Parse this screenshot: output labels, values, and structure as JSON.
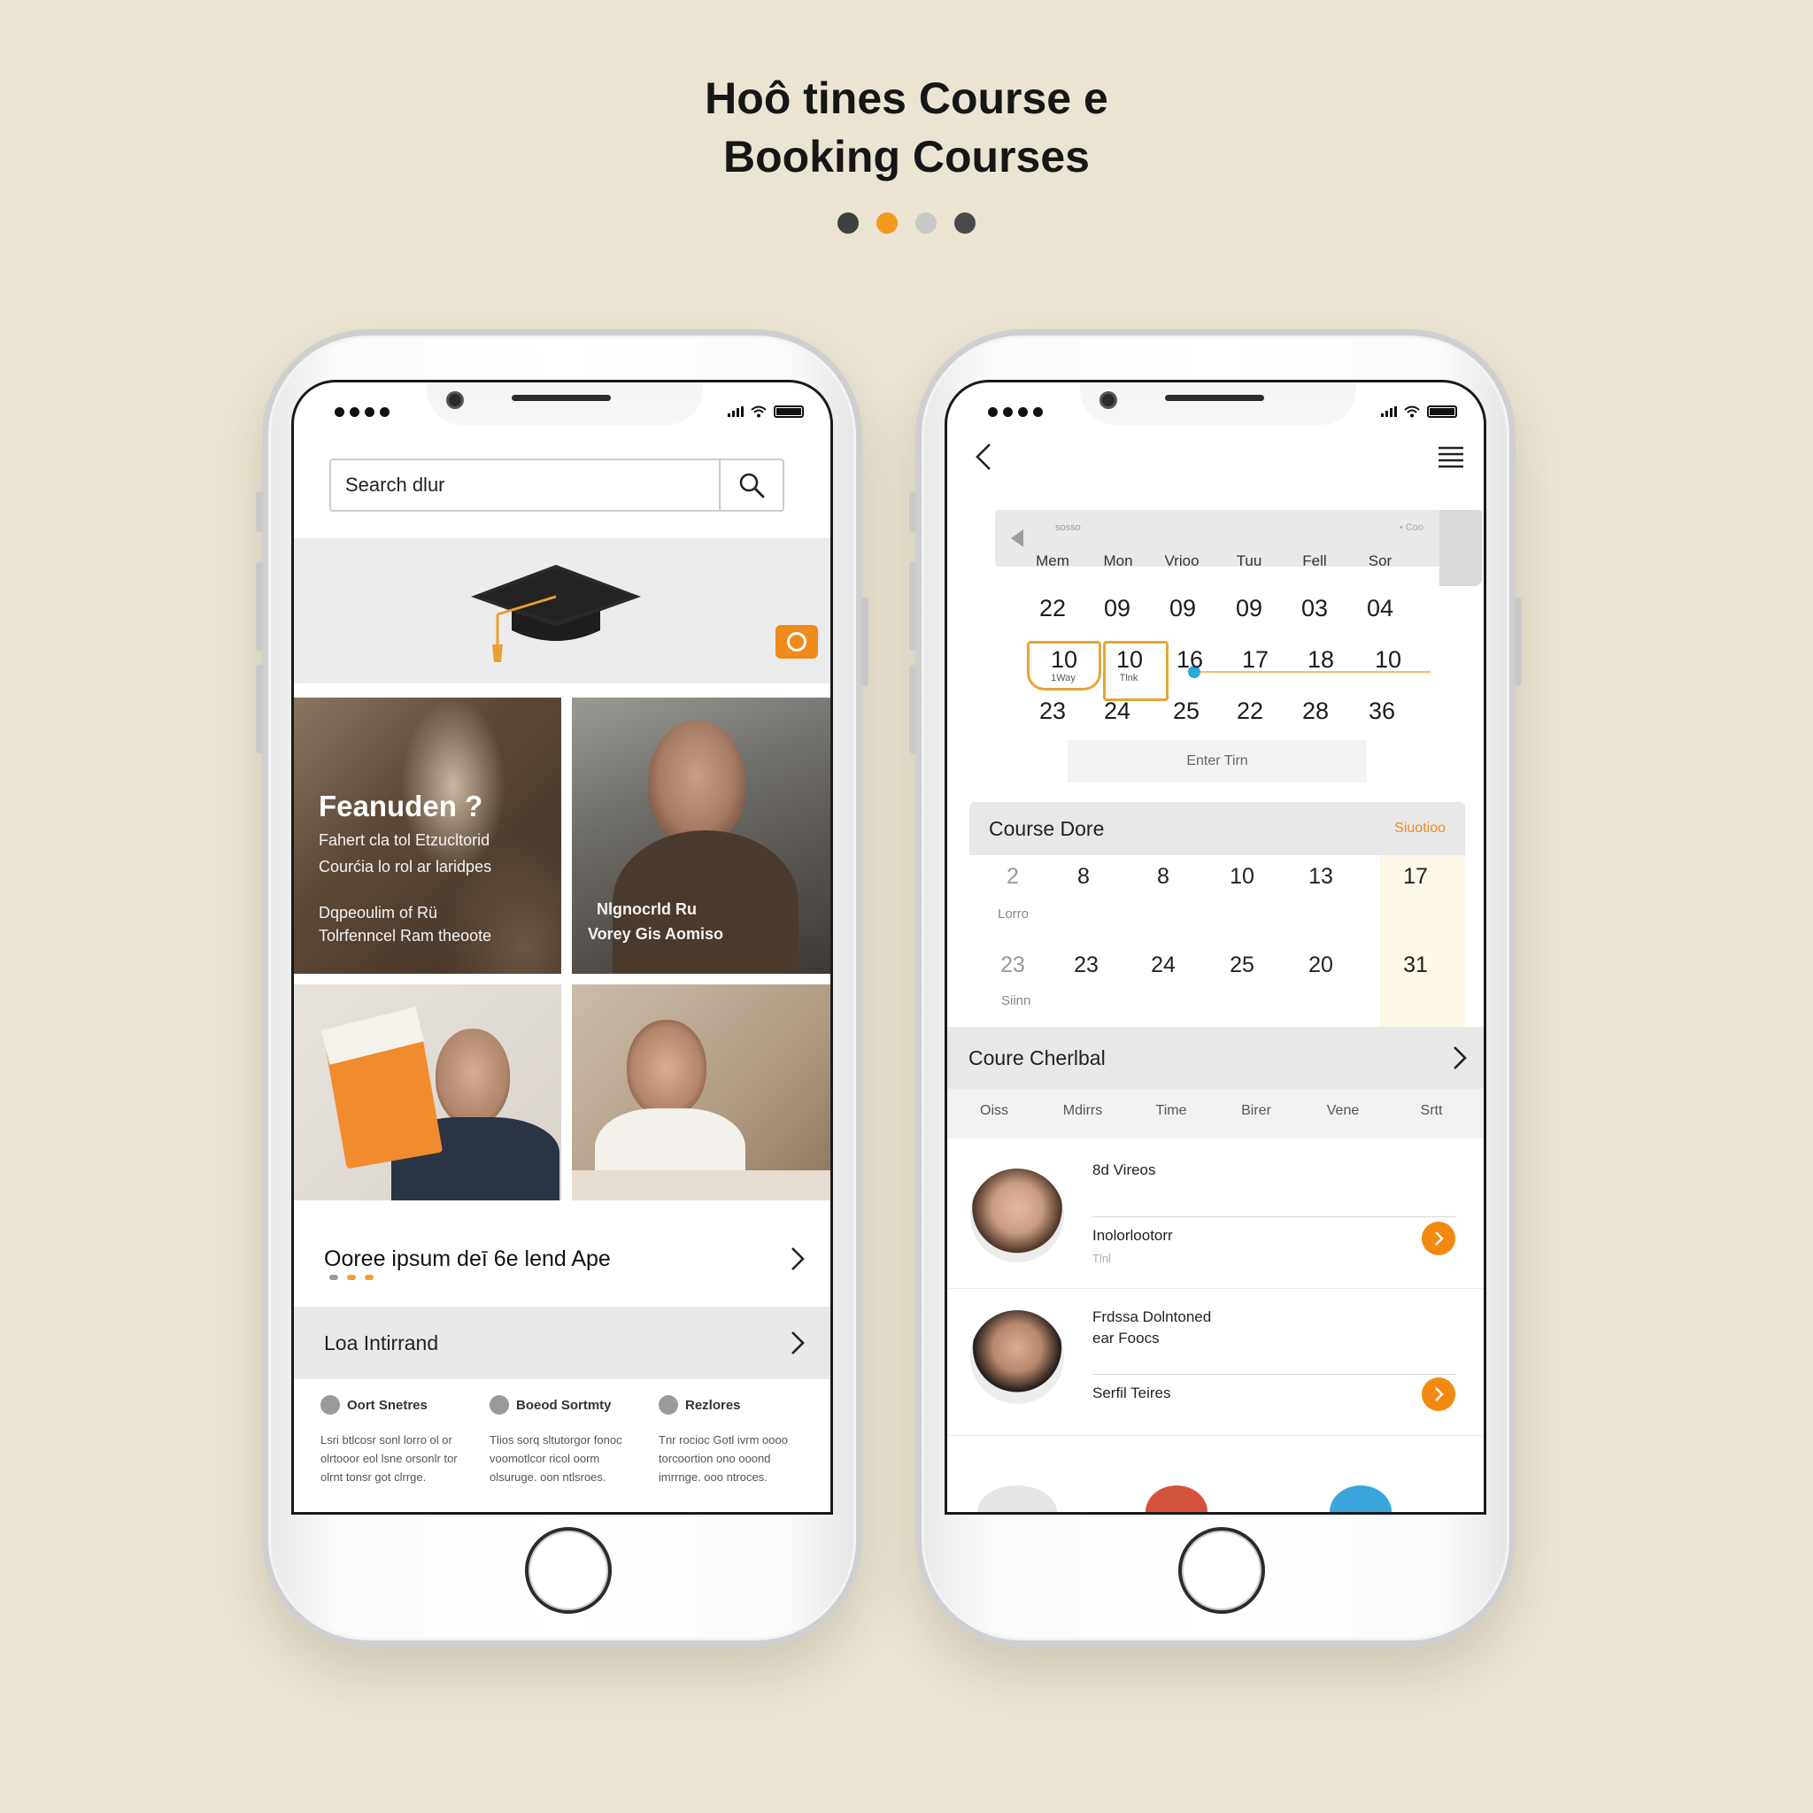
{
  "header": {
    "line1": "Hoô tines Course e",
    "line2": "Booking Courses",
    "pager_colors": [
      "#3f3f3f",
      "#f29a1e",
      "#c8c8c8",
      "#4a4a4a"
    ]
  },
  "left_phone": {
    "search": {
      "value": "Search dlur",
      "icon": "search-icon"
    },
    "hero": {
      "icon": "graduation-cap-icon",
      "badge_icon": "camera-icon",
      "badge_color": "#f08a1c"
    },
    "featured": {
      "title": "Feanuden ?",
      "lines": [
        "Fahert cla tol Etzucltorid",
        "Courćia lo rol ar laridpes"
      ],
      "lines2": [
        "Dqpeoulim of Rü",
        "Tolrfenncel Ram theoote"
      ]
    },
    "tile2": {
      "lines": [
        "Nlgnocrld Ru",
        "Vorey Gis Aomiso"
      ]
    },
    "row1": {
      "label": "Ooree ipsum deī 6e lend Ape",
      "icon": "chevron-right-icon"
    },
    "row2": {
      "label": "Loa Intirrand",
      "icon": "chevron-right-icon"
    },
    "features": [
      {
        "title": "Oort Snetres",
        "text": "Lsri btlcosr sonl lorro ol or olrtooor eol lsne orsonlr tor olrnt tonsr got clrrge."
      },
      {
        "title": "Boeod Sortmty",
        "text": "Tlios sorq sltutorgor fonoc voomotlcor ricol oorm olsuruge. oon ntlsroes."
      },
      {
        "title": "Rezlores",
        "text": "Tnr rocioc Gotl ivrm oooo torcoortion ono ooond imrrnge. ooo ntroces."
      }
    ]
  },
  "right_phone": {
    "nav": {
      "back_icon": "back-arrow-icon",
      "menu_icon": "hamburger-menu-icon"
    },
    "calendar": {
      "head_label": "sosso",
      "head_dots": "• Coo",
      "weekdays": [
        "Mem",
        "Mon",
        "Vrioo",
        "Tuu",
        "Fell",
        "Sor"
      ],
      "week1": [
        "22",
        "09",
        "09",
        "09",
        "03",
        "04"
      ],
      "week2": [
        "10",
        "10",
        "16",
        "17",
        "18",
        "10"
      ],
      "week2_sub": [
        "1Way",
        "Tlnk"
      ],
      "week3": [
        "23",
        "24",
        "25",
        "22",
        "28",
        "36"
      ],
      "enter_button": "Enter Tirn"
    },
    "course_panel": {
      "title": "Course Dore",
      "status": "Siuotioo",
      "row1": [
        "2",
        "8",
        "8",
        "10",
        "13",
        "17"
      ],
      "row1_label": "Lorro",
      "row2": [
        "23",
        "23",
        "24",
        "25",
        "20",
        "31"
      ],
      "row2_label": "Siinn"
    },
    "schedule": {
      "title": "Coure Cherlbal",
      "columns": [
        "Oiss",
        "Mdirrs",
        "Time",
        "Birer",
        "Vene",
        "Srtt"
      ]
    },
    "instructors": [
      {
        "line1": "8d Vireos",
        "line2": "Inolorlootorr",
        "sub": "Tlnl"
      },
      {
        "line1": "Frdssa Dolntoned",
        "line1b": "ear Foocs",
        "line2": "Serfil Teires"
      }
    ]
  }
}
